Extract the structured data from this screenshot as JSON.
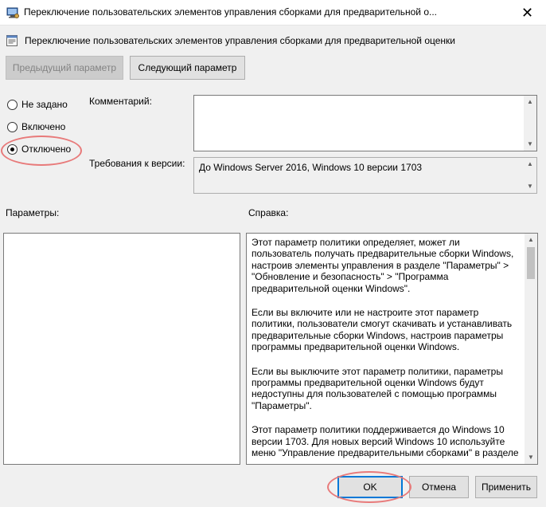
{
  "window": {
    "title": "Переключение пользовательских элементов управления сборками для предварительной о...",
    "close_glyph": "✕"
  },
  "header": {
    "policy_title": "Переключение пользовательских элементов управления сборками для предварительной оценки"
  },
  "nav": {
    "prev_label": "Предыдущий параметр",
    "next_label": "Следующий параметр"
  },
  "state": {
    "options": [
      {
        "label": "Не задано",
        "checked": false
      },
      {
        "label": "Включено",
        "checked": false
      },
      {
        "label": "Отключено",
        "checked": true
      }
    ]
  },
  "comment": {
    "label": "Комментарий:",
    "value": ""
  },
  "version": {
    "label": "Требования к версии:",
    "value": "До Windows Server 2016, Windows 10 версии 1703"
  },
  "params": {
    "label": "Параметры:"
  },
  "help": {
    "label": "Справка:",
    "paragraphs": [
      "Этот параметр политики определяет, может ли пользователь получать предварительные сборки Windows, настроив элементы управления в разделе \"Параметры\" > \"Обновление и безопасность\" > \"Программа предварительной оценки Windows\".",
      "Если вы включите или не настроите этот параметр политики, пользователи смогут скачивать и устанавливать предварительные сборки Windows, настроив параметры программы предварительной оценки Windows.",
      "Если вы выключите этот параметр политики, параметры программы предварительной оценки Windows будут недоступны для пользователей с помощью программы \"Параметры\".",
      "Этот параметр политики поддерживается до Windows 10 версии 1703. Для новых версий Windows 10 используйте меню \"Управление предварительными сборками\" в разделе"
    ]
  },
  "footer": {
    "ok_label": "OK",
    "cancel_label": "Отмена",
    "apply_label": "Применить"
  },
  "colors": {
    "highlight_oval": "#e87a7a",
    "accent": "#0078d7"
  },
  "icons": [
    "policy-window-icon",
    "policy-setting-icon",
    "close-icon",
    "scroll-up-icon",
    "scroll-down-icon"
  ]
}
